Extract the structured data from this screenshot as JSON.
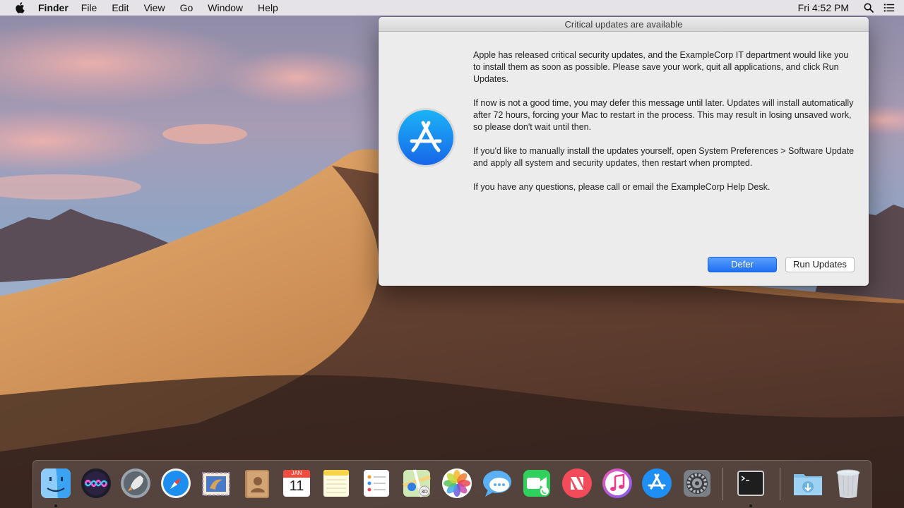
{
  "menubar": {
    "app_name": "Finder",
    "items": [
      "File",
      "Edit",
      "View",
      "Go",
      "Window",
      "Help"
    ],
    "clock": "Fri 4:52 PM",
    "right_icons": [
      "spotlight-search-icon",
      "notification-center-icon"
    ]
  },
  "dialog": {
    "title": "Critical updates are available",
    "icon": "app-store-icon",
    "paragraphs": [
      "Apple has released critical security updates, and the ExampleCorp IT department would like you to install them as soon as possible. Please save your work, quit all applications, and click Run Updates.",
      "If now is not a good time, you may defer this message until later. Updates will install automatically after 72 hours, forcing your Mac to restart in the process. This may result in losing unsaved work, so please don't wait until then.",
      "If you'd like to manually install the updates yourself, open System Preferences > Software Update and apply all system and security updates, then restart when prompted.",
      "If you have any questions, please call or email the ExampleCorp Help Desk."
    ],
    "buttons": {
      "defer": "Defer",
      "run": "Run Updates"
    },
    "accent_color": "#1f6ff4"
  },
  "dock": {
    "apps": [
      {
        "name": "finder",
        "running": true
      },
      {
        "name": "siri",
        "running": false
      },
      {
        "name": "launchpad",
        "running": false
      },
      {
        "name": "safari",
        "running": false
      },
      {
        "name": "mail",
        "running": false
      },
      {
        "name": "contacts",
        "running": false
      },
      {
        "name": "calendar",
        "running": false,
        "month": "JAN",
        "day": "11"
      },
      {
        "name": "notes",
        "running": false
      },
      {
        "name": "reminders",
        "running": false
      },
      {
        "name": "maps",
        "running": false
      },
      {
        "name": "photos",
        "running": false
      },
      {
        "name": "messages",
        "running": false
      },
      {
        "name": "facetime",
        "running": false
      },
      {
        "name": "news",
        "running": false
      },
      {
        "name": "itunes",
        "running": false
      },
      {
        "name": "app-store",
        "running": false
      },
      {
        "name": "system-preferences",
        "running": false
      },
      {
        "name": "terminal",
        "running": true
      },
      {
        "name": "downloads",
        "running": false
      },
      {
        "name": "trash",
        "running": false
      }
    ]
  }
}
